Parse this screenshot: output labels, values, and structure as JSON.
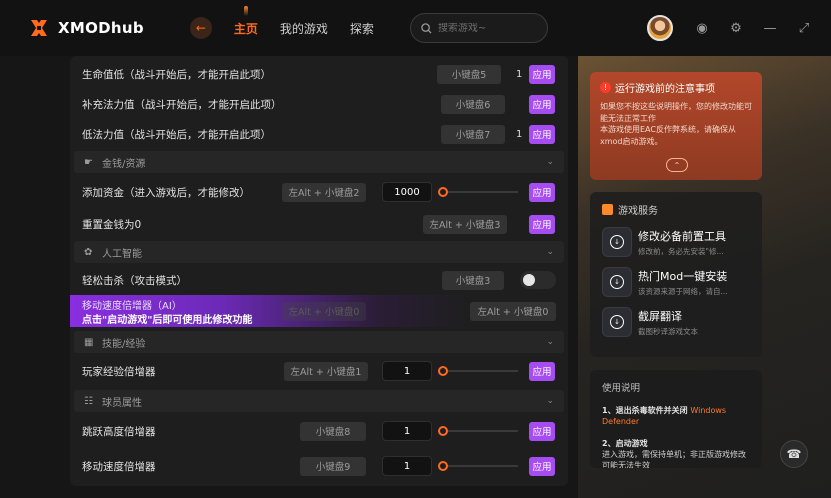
{
  "app": {
    "name": "XMODhub"
  },
  "nav": {
    "items": [
      "主页",
      "我的游戏",
      "探索"
    ],
    "active": 0
  },
  "search": {
    "placeholder": "搜索游戏~"
  },
  "colors": {
    "accent": "#ff6a1f",
    "apply": "#a64df2",
    "notice": "#b2472a"
  },
  "rows": {
    "r1": {
      "label": "生命值低（战斗开始后，才能开启此项）",
      "hotkey": "小键盘5",
      "value": "1",
      "apply": "应用"
    },
    "r2": {
      "label": "补充法力值（战斗开始后，才能开启此项）",
      "hotkey": "小键盘6",
      "apply": "应用"
    },
    "r3": {
      "label": "低法力值（战斗开始后，才能开启此项）",
      "hotkey": "小键盘7",
      "value": "1",
      "apply": "应用"
    },
    "sec1": {
      "label": "金钱/资源",
      "icon": "coin-icon"
    },
    "r4": {
      "label": "添加资金（进入游戏后，才能修改）",
      "hotkey": "左Alt + 小键盘2",
      "value": "1000",
      "apply": "应用"
    },
    "r5": {
      "label": "重置金钱为0",
      "hotkey": "左Alt + 小键盘3",
      "apply": "应用"
    },
    "sec2": {
      "label": "人工智能",
      "icon": "ai-icon"
    },
    "r6": {
      "label": "轻松击杀（攻击模式）",
      "hotkey": "小键盘3",
      "toggle": false
    },
    "r7": {
      "label": "移动速度倍增器（AI）",
      "promo": "点击\"启动游戏\"后即可使用此修改功能",
      "hotkey_faded": "左Alt + 小键盘0",
      "hotkey": "左Alt + 小键盘0"
    },
    "sec3": {
      "label": "技能/经验",
      "icon": "chart-icon"
    },
    "r8": {
      "label": "玩家经验倍增器",
      "hotkey": "左Alt + 小键盘1",
      "value": "1",
      "apply": "应用"
    },
    "sec4": {
      "label": "球员属性",
      "icon": "stats-icon"
    },
    "r9": {
      "label": "跳跃高度倍增器",
      "hotkey": "小键盘8",
      "value": "1",
      "apply": "应用"
    },
    "r10": {
      "label": "移动速度倍增器",
      "hotkey": "小键盘9",
      "value": "1",
      "apply": "应用"
    }
  },
  "notice": {
    "title": "运行游戏前的注意事项",
    "body_1": "如果您不按这些说明操作，您的修改功能可能无法正常工作",
    "body_2": "本游戏使用EAC反作弊系统，请确保从xmod启动游戏。"
  },
  "services": {
    "title": "游戏服务",
    "items": [
      {
        "title": "修改必备前置工具",
        "sub": "修改前，务必先安装\"修..."
      },
      {
        "title": "热门Mod一键安装",
        "sub": "该资源来源于网络，请自..."
      },
      {
        "title": "截屏翻译",
        "sub": "截图秒译游戏文本"
      }
    ]
  },
  "guide": {
    "title": "使用说明",
    "step1": "1、退出杀毒软件并关闭",
    "step1_hl": "Windows Defender",
    "step2": "2、启动游戏",
    "step2_body": "进入游戏，需保持单机；非正版游戏修改可能无法生效"
  }
}
